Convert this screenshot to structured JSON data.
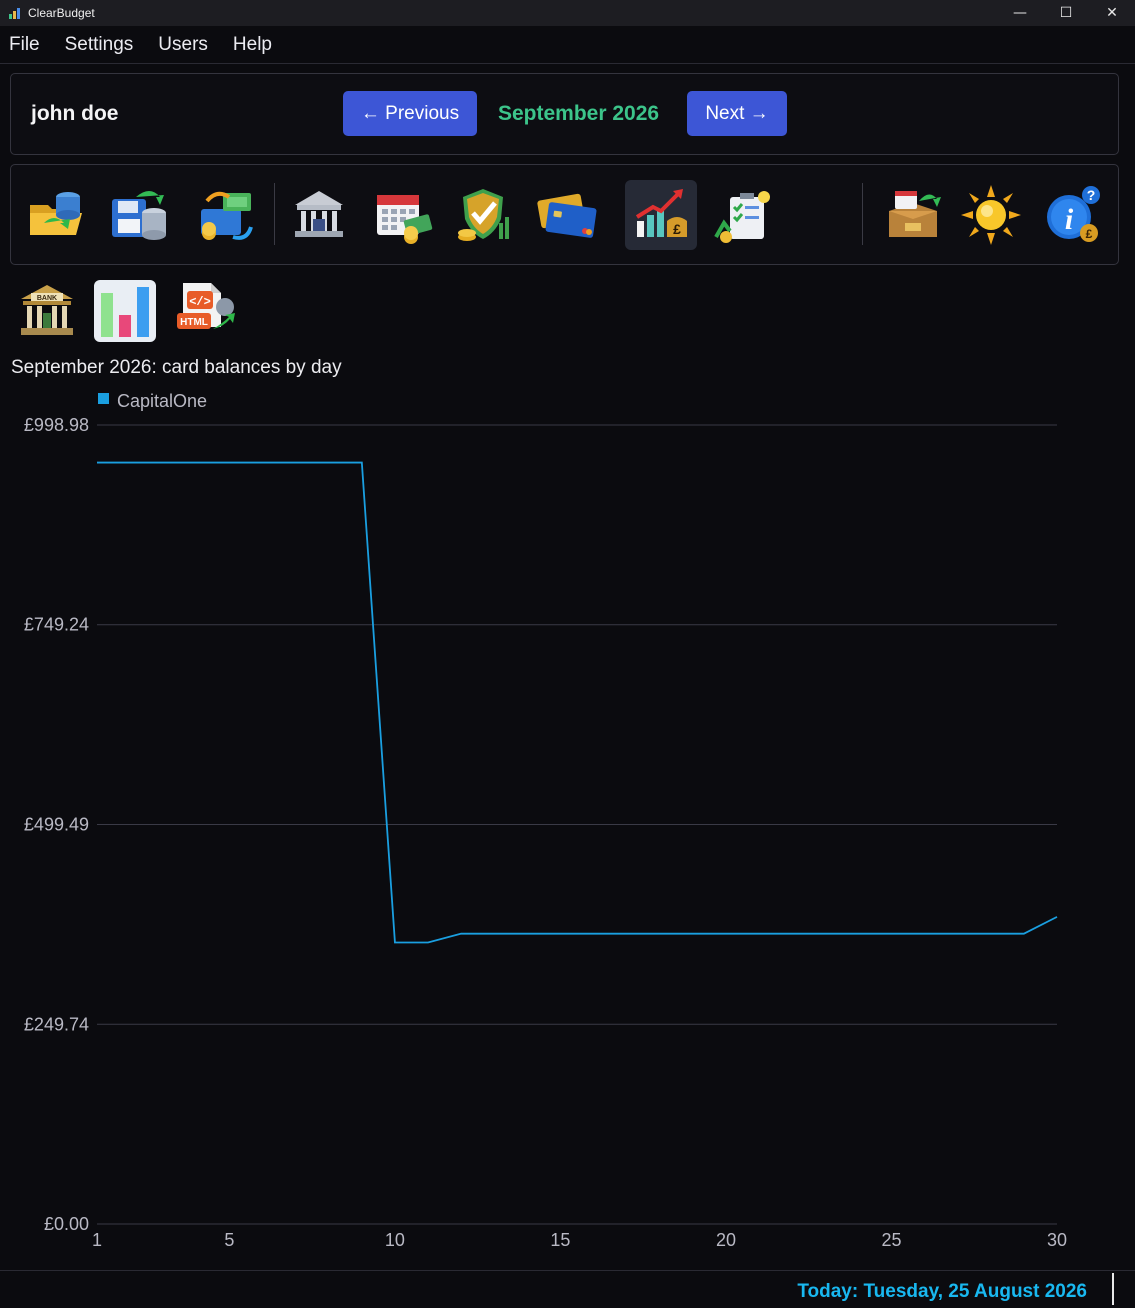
{
  "window": {
    "title": "ClearBudget",
    "controls": {
      "minimize": "—",
      "maximize": "☐",
      "close": "✕"
    }
  },
  "menu": [
    "File",
    "Settings",
    "Users",
    "Help"
  ],
  "header": {
    "user_name": "john doe",
    "prev_label": "← Previous",
    "month_label": "September 2026",
    "next_label": "Next →"
  },
  "toolbar": {
    "icons": [
      "database-import-icon",
      "save-database-icon",
      "money-exchange-icon",
      "bank-icon",
      "calendar-money-icon",
      "shield-coins-icon",
      "credit-cards-icon",
      "growth-chart-pound-icon",
      "checklist-coins-icon",
      "backup-box-icon",
      "sun-icon",
      "info-coins-icon"
    ],
    "active_icon": "growth-chart-pound-icon"
  },
  "subtoolbar": {
    "icons": [
      "bank-building-icon",
      "bar-chart-icon",
      "html-export-icon"
    ],
    "html_badge": "HTML",
    "bank_sign": "BANK"
  },
  "chart_title": "September 2026: card balances by day",
  "chart_data": {
    "type": "line",
    "title": "September 2026: card balances by day",
    "xlabel": "",
    "ylabel": "",
    "x": [
      1,
      2,
      3,
      4,
      5,
      6,
      7,
      8,
      9,
      10,
      11,
      12,
      13,
      14,
      15,
      16,
      17,
      18,
      19,
      20,
      21,
      22,
      23,
      24,
      25,
      26,
      27,
      28,
      29,
      30
    ],
    "series": [
      {
        "name": "CapitalOne",
        "color": "#1a9fe0",
        "values": [
          952,
          952,
          952,
          952,
          952,
          952,
          952,
          952,
          952,
          352,
          352,
          363,
          363,
          363,
          363,
          363,
          363,
          363,
          363,
          363,
          363,
          363,
          363,
          363,
          363,
          363,
          363,
          363,
          363,
          384
        ]
      }
    ],
    "ylim": [
      0,
      998.98
    ],
    "yticks": [
      0,
      249.74,
      499.49,
      749.24,
      998.98
    ],
    "ytick_labels": [
      "£0.00",
      "£249.74",
      "£499.49",
      "£749.24",
      "£998.98"
    ],
    "xticks": [
      1,
      5,
      10,
      15,
      20,
      25,
      30
    ],
    "xtick_labels": [
      "1",
      "5",
      "10",
      "15",
      "20",
      "25",
      "30"
    ],
    "grid": true,
    "legend": "top-left"
  },
  "status": {
    "today": "Today: Tuesday, 25 August 2026"
  }
}
